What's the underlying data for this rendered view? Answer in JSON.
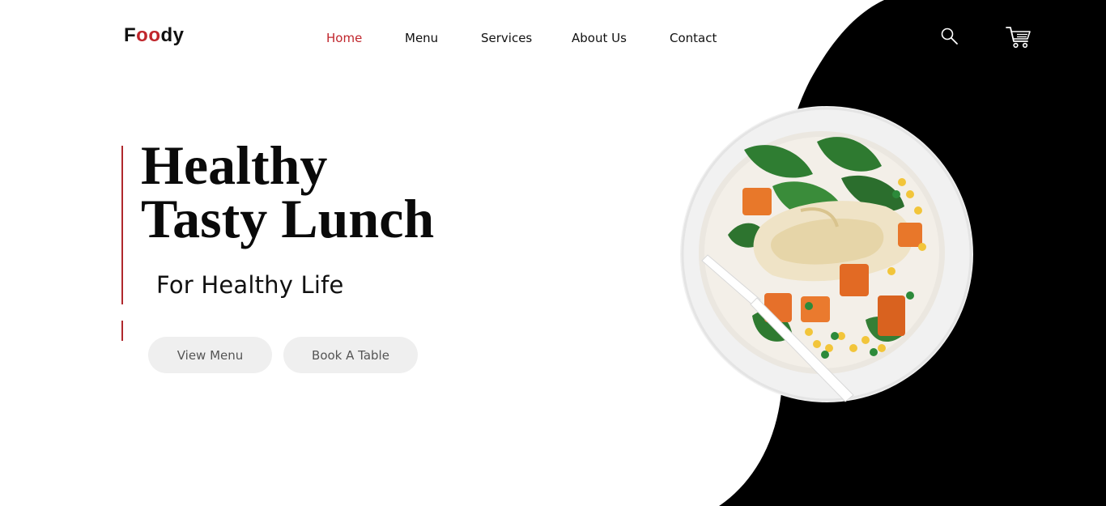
{
  "brand": {
    "part1": "F",
    "part2": "oo",
    "part3": "dy"
  },
  "nav": {
    "items": [
      {
        "label": "Home",
        "active": true
      },
      {
        "label": "Menu",
        "active": false
      },
      {
        "label": "Services",
        "active": false
      },
      {
        "label": "About Us",
        "active": false
      },
      {
        "label": "Contact",
        "active": false
      }
    ]
  },
  "actions": {
    "search_icon": "search-icon",
    "cart_icon": "cart-icon"
  },
  "hero": {
    "title_line1": "Healthy",
    "title_line2": "Tasty Lunch",
    "subtitle": "For Healthy Life",
    "buttons": {
      "view_menu": "View Menu",
      "book_table": "Book A Table"
    }
  },
  "image": {
    "description_icon": "salad-plate-image"
  },
  "colors": {
    "accent": "#c0262c",
    "dark_panel": "#000000",
    "button_bg": "#efefef"
  }
}
